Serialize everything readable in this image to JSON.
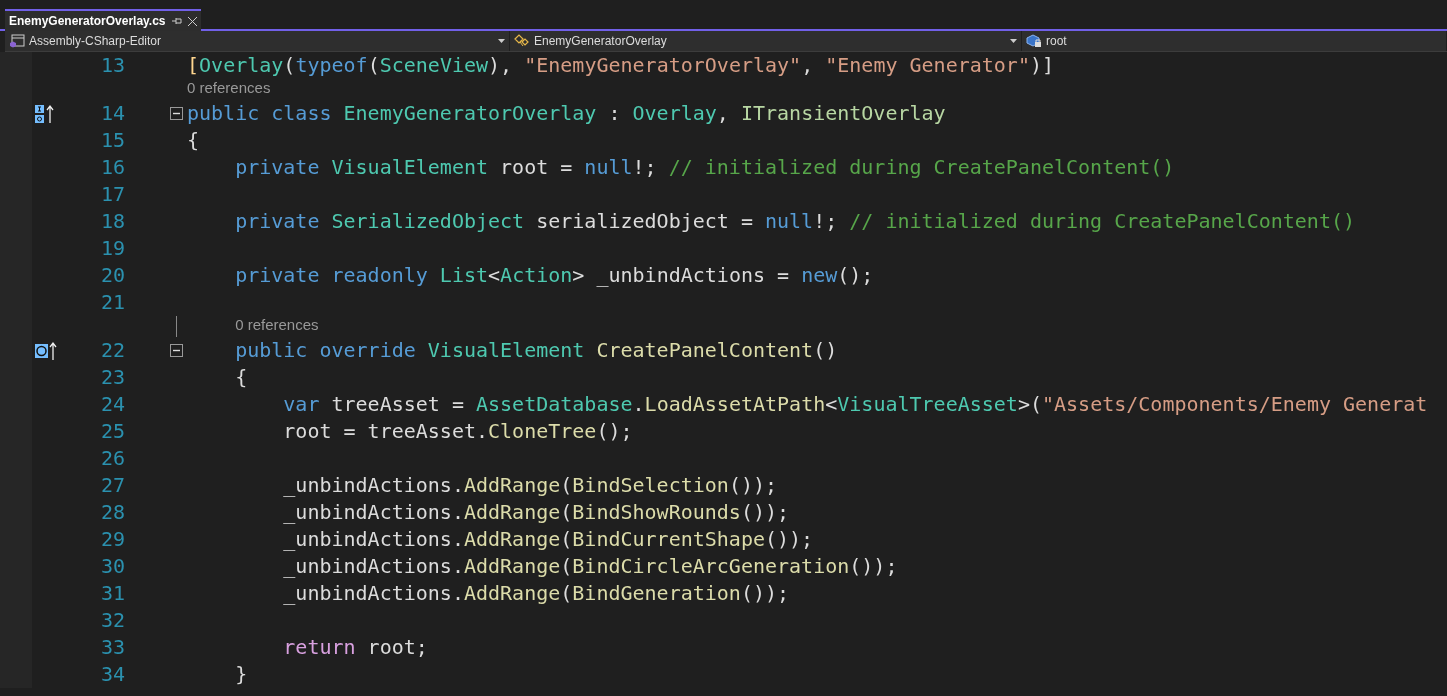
{
  "tabs": [
    {
      "title": "EnemyGeneratorOverlay.cs",
      "selected": true
    }
  ],
  "navigation": [
    {
      "text": "Assembly-CSharp-Editor"
    },
    {
      "text": "EnemyGeneratorOverlay"
    },
    {
      "text": "root"
    }
  ],
  "lines": [
    {
      "number": "13",
      "tokens": [
        {
          "kind": "punct",
          "text": "["
        },
        {
          "kind": "type",
          "text": "Overlay"
        },
        {
          "kind": "plain",
          "text": "("
        },
        {
          "kind": "keyword",
          "text": "typeof"
        },
        {
          "kind": "plain",
          "text": "("
        },
        {
          "kind": "type",
          "text": "SceneView"
        },
        {
          "kind": "plain",
          "text": "), "
        },
        {
          "kind": "string",
          "text": "\"EnemyGeneratorOverlay\""
        },
        {
          "kind": "plain",
          "text": ", "
        },
        {
          "kind": "string",
          "text": "\"Enemy Generator\""
        },
        {
          "kind": "plain",
          "text": ")]"
        }
      ]
    },
    {
      "number": "14",
      "references": "0 references",
      "glyph": {
        "kind": "implements"
      },
      "fold": true,
      "tokens": [
        {
          "kind": "keyword",
          "text": "public class"
        },
        {
          "kind": "type",
          "text": " EnemyGeneratorOverlay"
        },
        {
          "kind": "plain",
          "text": " : "
        },
        {
          "kind": "type",
          "text": "Overlay"
        },
        {
          "kind": "plain",
          "text": ", "
        },
        {
          "kind": "interface",
          "text": "ITransientOverlay"
        }
      ]
    },
    {
      "number": "15",
      "tokens": [
        {
          "kind": "plain",
          "text": "{"
        }
      ]
    },
    {
      "number": "16",
      "tokens": [
        {
          "kind": "keyword",
          "text": "    private"
        },
        {
          "kind": "type",
          "text": " VisualElement"
        },
        {
          "kind": "plain",
          "text": " root = "
        },
        {
          "kind": "keyword",
          "text": "null"
        },
        {
          "kind": "plain",
          "text": "!; "
        },
        {
          "kind": "comment",
          "text": "// initialized during CreatePanelContent()"
        }
      ]
    },
    {
      "number": "17"
    },
    {
      "number": "18",
      "tokens": [
        {
          "kind": "keyword",
          "text": "    private"
        },
        {
          "kind": "type",
          "text": " SerializedObject"
        },
        {
          "kind": "plain",
          "text": " serializedObject = "
        },
        {
          "kind": "keyword",
          "text": "null"
        },
        {
          "kind": "plain",
          "text": "!; "
        },
        {
          "kind": "comment",
          "text": "// initialized during CreatePanelContent()"
        }
      ]
    },
    {
      "number": "19"
    },
    {
      "number": "20",
      "tokens": [
        {
          "kind": "keyword",
          "text": "    private readonly"
        },
        {
          "kind": "type",
          "text": " List"
        },
        {
          "kind": "plain",
          "text": "<"
        },
        {
          "kind": "type",
          "text": "Action"
        },
        {
          "kind": "plain",
          "text": "> _unbindActions = "
        },
        {
          "kind": "keyword",
          "text": "new"
        },
        {
          "kind": "plain",
          "text": "();"
        }
      ]
    },
    {
      "number": "21"
    },
    {
      "number": "22",
      "references": "0 references",
      "glyph": {
        "kind": "overrides"
      },
      "fold": true,
      "tokens": [
        {
          "kind": "keyword",
          "text": "    public override"
        },
        {
          "kind": "type",
          "text": " VisualElement"
        },
        {
          "kind": "method",
          "text": " CreatePanelContent"
        },
        {
          "kind": "plain",
          "text": "()"
        }
      ]
    },
    {
      "number": "23",
      "tokens": [
        {
          "kind": "plain",
          "text": "    {"
        }
      ]
    },
    {
      "number": "24",
      "tokens": [
        {
          "kind": "keyword",
          "text": "        var"
        },
        {
          "kind": "plain",
          "text": " treeAsset = "
        },
        {
          "kind": "type",
          "text": "AssetDatabase"
        },
        {
          "kind": "plain",
          "text": "."
        },
        {
          "kind": "method",
          "text": "LoadAssetAtPath"
        },
        {
          "kind": "plain",
          "text": "<"
        },
        {
          "kind": "type",
          "text": "VisualTreeAsset"
        },
        {
          "kind": "plain",
          "text": ">("
        },
        {
          "kind": "string",
          "text": "\"Assets/Components/Enemy Generat"
        }
      ]
    },
    {
      "number": "25",
      "tokens": [
        {
          "kind": "plain",
          "text": "        root = treeAsset."
        },
        {
          "kind": "method",
          "text": "CloneTree"
        },
        {
          "kind": "plain",
          "text": "();"
        }
      ]
    },
    {
      "number": "26"
    },
    {
      "number": "27",
      "tokens": [
        {
          "kind": "plain",
          "text": "        _unbindActions."
        },
        {
          "kind": "method",
          "text": "AddRange"
        },
        {
          "kind": "plain",
          "text": "("
        },
        {
          "kind": "method",
          "text": "BindSelection"
        },
        {
          "kind": "plain",
          "text": "());"
        }
      ]
    },
    {
      "number": "28",
      "tokens": [
        {
          "kind": "plain",
          "text": "        _unbindActions."
        },
        {
          "kind": "method",
          "text": "AddRange"
        },
        {
          "kind": "plain",
          "text": "("
        },
        {
          "kind": "method",
          "text": "BindShowRounds"
        },
        {
          "kind": "plain",
          "text": "());"
        }
      ]
    },
    {
      "number": "29",
      "tokens": [
        {
          "kind": "plain",
          "text": "        _unbindActions."
        },
        {
          "kind": "method",
          "text": "AddRange"
        },
        {
          "kind": "plain",
          "text": "("
        },
        {
          "kind": "method",
          "text": "BindCurrentShape"
        },
        {
          "kind": "plain",
          "text": "());"
        }
      ]
    },
    {
      "number": "30",
      "tokens": [
        {
          "kind": "plain",
          "text": "        _unbindActions."
        },
        {
          "kind": "method",
          "text": "AddRange"
        },
        {
          "kind": "plain",
          "text": "("
        },
        {
          "kind": "method",
          "text": "BindCircleArcGeneration"
        },
        {
          "kind": "plain",
          "text": "());"
        }
      ]
    },
    {
      "number": "31",
      "tokens": [
        {
          "kind": "plain",
          "text": "        _unbindActions."
        },
        {
          "kind": "method",
          "text": "AddRange"
        },
        {
          "kind": "plain",
          "text": "("
        },
        {
          "kind": "method",
          "text": "BindGeneration"
        },
        {
          "kind": "plain",
          "text": "());"
        }
      ]
    },
    {
      "number": "32"
    },
    {
      "number": "33",
      "tokens": [
        {
          "kind": "control",
          "text": "        return"
        },
        {
          "kind": "plain",
          "text": " root;"
        }
      ]
    },
    {
      "number": "34",
      "tokens": [
        {
          "kind": "plain",
          "text": "    }"
        }
      ]
    }
  ]
}
